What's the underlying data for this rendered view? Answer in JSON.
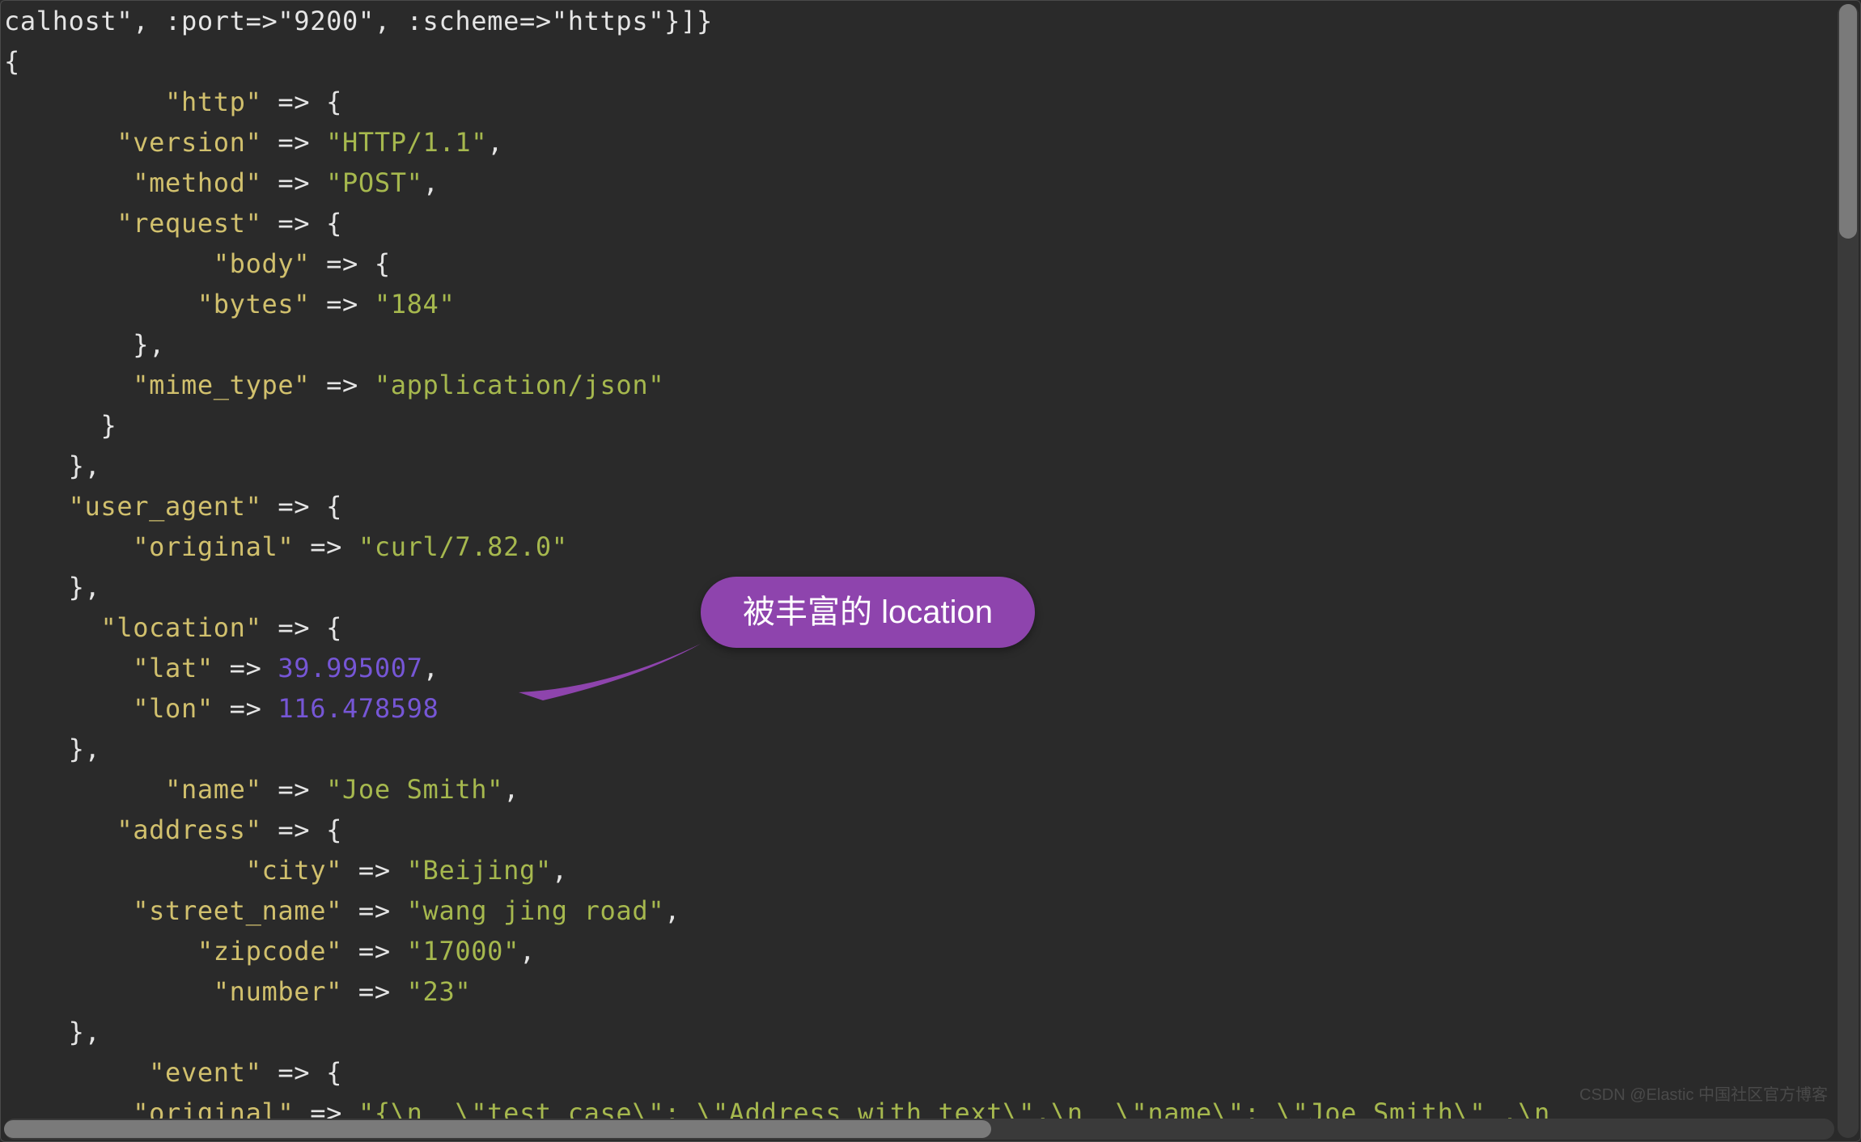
{
  "code": {
    "header_line": "calhost\", :port=>\"9200\", :scheme=>\"https\"}]}",
    "open_brace": "{",
    "http": {
      "key": "\"http\"",
      "version_key": "\"version\"",
      "version_val": "\"HTTP/1.1\"",
      "method_key": "\"method\"",
      "method_val": "\"POST\"",
      "request_key": "\"request\"",
      "body_key": "\"body\"",
      "bytes_key": "\"bytes\"",
      "bytes_val": "\"184\"",
      "mime_key": "\"mime_type\"",
      "mime_val": "\"application/json\""
    },
    "user_agent": {
      "key": "\"user_agent\"",
      "original_key": "\"original\"",
      "original_val": "\"curl/7.82.0\""
    },
    "location": {
      "key": "\"location\"",
      "lat_key": "\"lat\"",
      "lat_val": "39.995007",
      "lon_key": "\"lon\"",
      "lon_val": "116.478598"
    },
    "name_key": "\"name\"",
    "name_val": "\"Joe Smith\"",
    "address": {
      "key": "\"address\"",
      "city_key": "\"city\"",
      "city_val": "\"Beijing\"",
      "street_key": "\"street_name\"",
      "street_val": "\"wang jing road\"",
      "zipcode_key": "\"zipcode\"",
      "zipcode_val": "\"17000\"",
      "number_key": "\"number\"",
      "number_val": "\"23\""
    },
    "event": {
      "key": "\"event\"",
      "original_key": "\"original\"",
      "original_val": "\"{\\n  \\\"test_case\\\": \\\"Address with text\\\",\\n  \\\"name\\\": \\\"Joe Smith\\\" ,\\n"
    },
    "arrow": " => ",
    "ob": "{",
    "cb": "}",
    "comma": ","
  },
  "callout": {
    "text": "被丰富的 location"
  },
  "watermark": "CSDN @Elastic 中国社区官方博客"
}
